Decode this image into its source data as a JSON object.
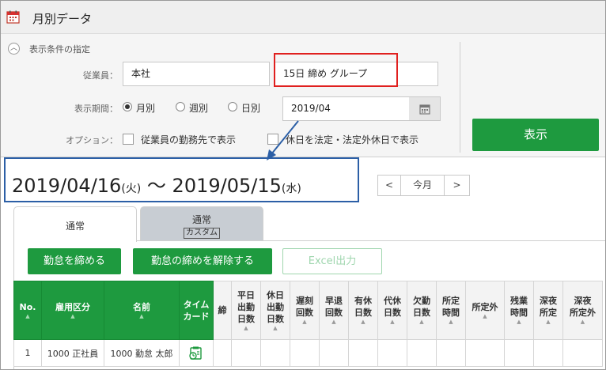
{
  "window": {
    "title": "月別データ"
  },
  "filter": {
    "header": "表示条件の指定",
    "employee_label": "従業員：",
    "employee_value": "本社",
    "group_value": "15日 締め グループ",
    "period_label": "表示期間：",
    "period_options": [
      {
        "label": "月別",
        "selected": true
      },
      {
        "label": "週別",
        "selected": false
      },
      {
        "label": "日別",
        "selected": false
      }
    ],
    "period_value": "2019/04",
    "option_label": "オプション：",
    "options": [
      {
        "label": "従業員の勤務先で表示",
        "checked": false
      },
      {
        "label": "休日を法定・法定外休日で表示",
        "checked": false
      }
    ],
    "show_button": "表示"
  },
  "range": {
    "start": "2019/04/16",
    "start_dow": "(火)",
    "sep": "〜",
    "end": "2019/05/15",
    "end_dow": "(水)"
  },
  "nav": {
    "prev": "<",
    "today": "今月",
    "next": ">"
  },
  "tabs": [
    {
      "label": "通常",
      "sub": "",
      "active": true
    },
    {
      "label": "通常",
      "sub": "カスタム",
      "active": false
    }
  ],
  "actions": {
    "close": "勤怠を締める",
    "unclose": "勤怠の締めを解除する",
    "excel": "Excel出力"
  },
  "table": {
    "columns": [
      {
        "label": "No.",
        "green": true
      },
      {
        "label": "雇用区分",
        "green": true
      },
      {
        "label": "名前",
        "green": true
      },
      {
        "label": "タイム\nカード",
        "green": true
      },
      {
        "label": "締",
        "green": false
      },
      {
        "label": "平日\n出勤\n日数",
        "green": false
      },
      {
        "label": "休日\n出勤\n日数",
        "green": false
      },
      {
        "label": "遅刻\n回数",
        "green": false
      },
      {
        "label": "早退\n回数",
        "green": false
      },
      {
        "label": "有休\n日数",
        "green": false
      },
      {
        "label": "代休\n日数",
        "green": false
      },
      {
        "label": "欠勤\n日数",
        "green": false
      },
      {
        "label": "所定\n時間",
        "green": false
      },
      {
        "label": "所定外",
        "green": false
      },
      {
        "label": "残業\n時間",
        "green": false
      },
      {
        "label": "深夜\n所定",
        "green": false
      },
      {
        "label": "深夜\n所定外",
        "green": false
      }
    ],
    "rows": [
      {
        "no": "1",
        "type": "1000 正社員",
        "name": "1000 勤怠 太郎"
      }
    ]
  },
  "colors": {
    "accent_green": "#1e9a3f",
    "highlight_red": "#e0201f",
    "highlight_blue": "#2c5fa6"
  }
}
